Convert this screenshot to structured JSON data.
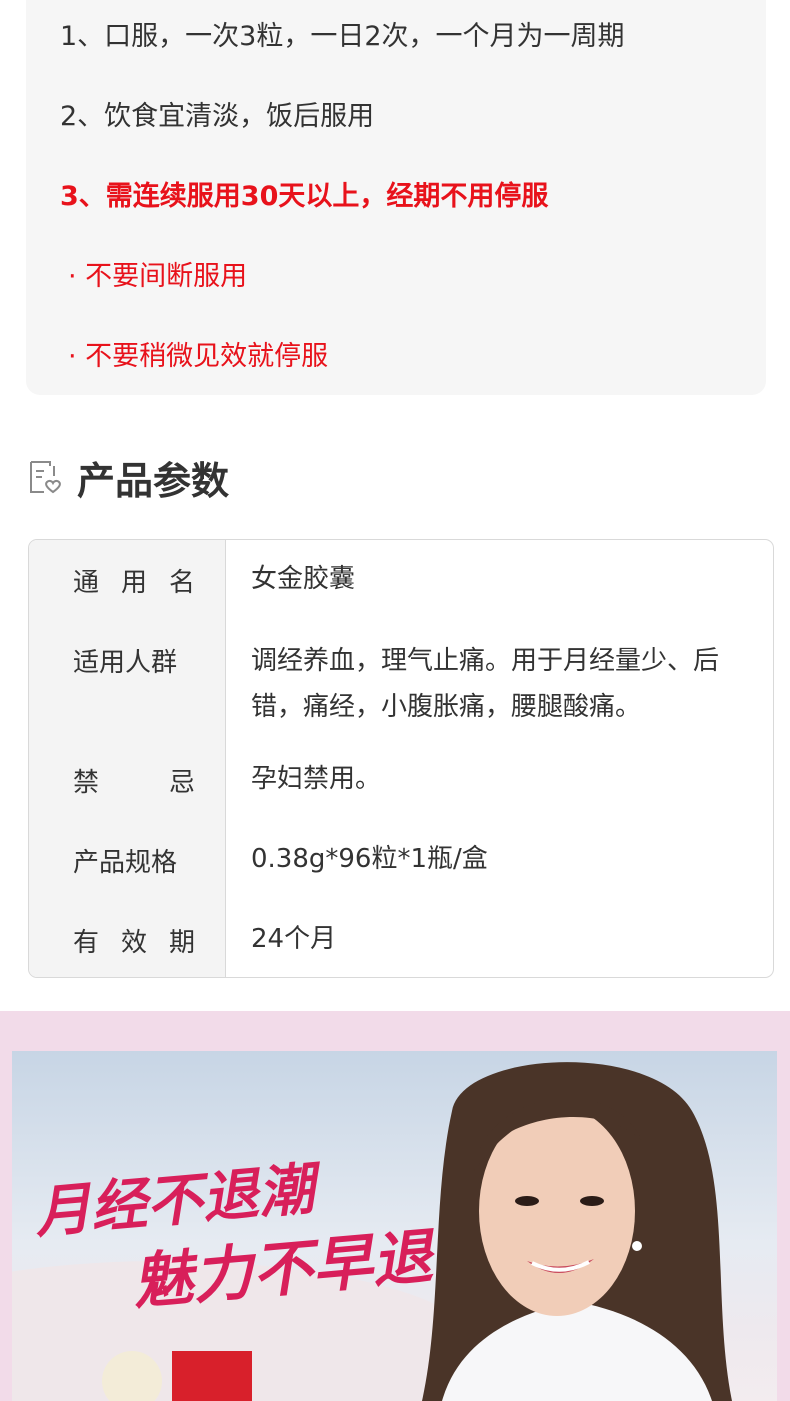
{
  "usage": {
    "line1": "1、口服，一次3粒，一日2次，一个月为一周期",
    "line2": "2、饮食宜清淡，饭后服用",
    "line3": "3、需连续服用30天以上，经期不用停服",
    "bullet1": "· 不要间断服用",
    "bullet2": "· 不要稍微见效就停服"
  },
  "section": {
    "title": "产品参数",
    "icon": "document-heart-icon"
  },
  "params": {
    "generic_name_label": [
      "通",
      "用",
      "名"
    ],
    "generic_name": "女金胶囊",
    "target_label": "适用人群",
    "target": "调经养血，理气止痛。用于月经量少、后错，痛经，小腹胀痛，腰腿酸痛。",
    "contra_label": [
      "禁",
      "忌"
    ],
    "contra": "孕妇禁用。",
    "spec_label": "产品规格",
    "spec": "0.38g*96粒*1瓶/盒",
    "expiry_label": [
      "有",
      "效",
      "期"
    ],
    "expiry": "24个月"
  },
  "banner": {
    "slogan1": "月经不退潮",
    "slogan2": "魅力不早退"
  },
  "colors": {
    "accent_red": "#e8121b",
    "slogan_pink": "#d81f5a",
    "banner_bg": "#f2dbe9"
  }
}
